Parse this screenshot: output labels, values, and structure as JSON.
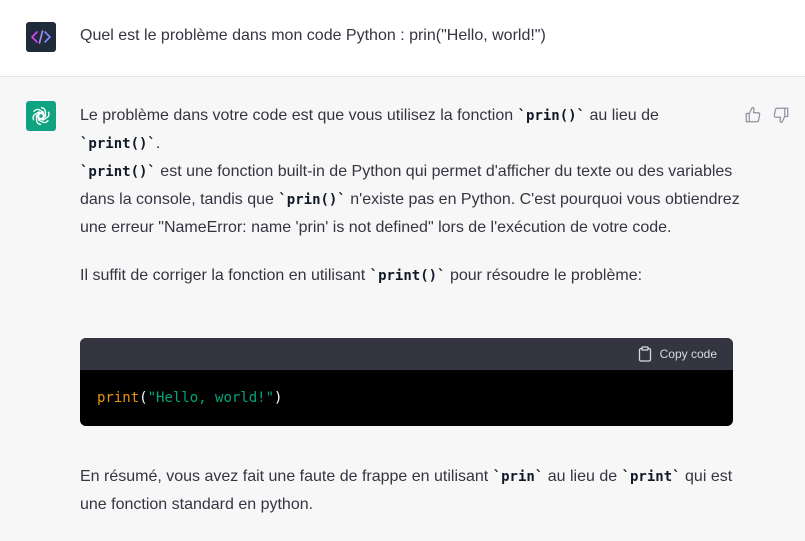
{
  "user_message": {
    "text": "Quel est le problème dans mon code Python : prin(\"Hello, world!\")",
    "avatar_icon": "code-brackets-icon"
  },
  "assistant": {
    "avatar_icon": "openai-logo-icon",
    "para1": {
      "t1": "Le problème dans votre code est que vous utilisez la fonction ",
      "c1": "`prin()`",
      "t2": " au lieu de ",
      "c2": "`print()`",
      "t3": "."
    },
    "para2": {
      "c1": "`print()`",
      "t1": " est une fonction built-in de Python qui permet d'afficher du texte ou des variables dans la console, tandis que ",
      "c2": "`prin()`",
      "t2": " n'existe pas en Python. C'est pourquoi vous obtiendrez une erreur \"NameError: name 'prin' is not defined\" lors de l'exécution de votre code."
    },
    "para3": {
      "t1": "Il suffit de corriger la fonction en utilisant ",
      "c1": "`print()`",
      "t2": " pour résoudre le problème:"
    },
    "code_block": {
      "copy_label": "Copy code",
      "tokens": {
        "fn": "print",
        "open": "(",
        "str": "\"Hello, world!\"",
        "close": ")"
      }
    },
    "summary": {
      "t1": "En résumé, vous avez fait une faute de frappe en utilisant ",
      "c1": "`prin`",
      "t2": " au lieu de ",
      "c2": "`print`",
      "t3": " qui est une fonction standard en python."
    },
    "feedback": {
      "thumbs_up_icon": "thumbs-up-icon",
      "thumbs_down_icon": "thumbs-down-icon"
    }
  },
  "colors": {
    "user_avatar_bg": "#1f2a3a",
    "bot_avatar_bg": "#10a37f",
    "code_header_bg": "#343541",
    "code_bg": "#000000",
    "string_color": "#00a67d",
    "function_color": "#e9950c"
  }
}
